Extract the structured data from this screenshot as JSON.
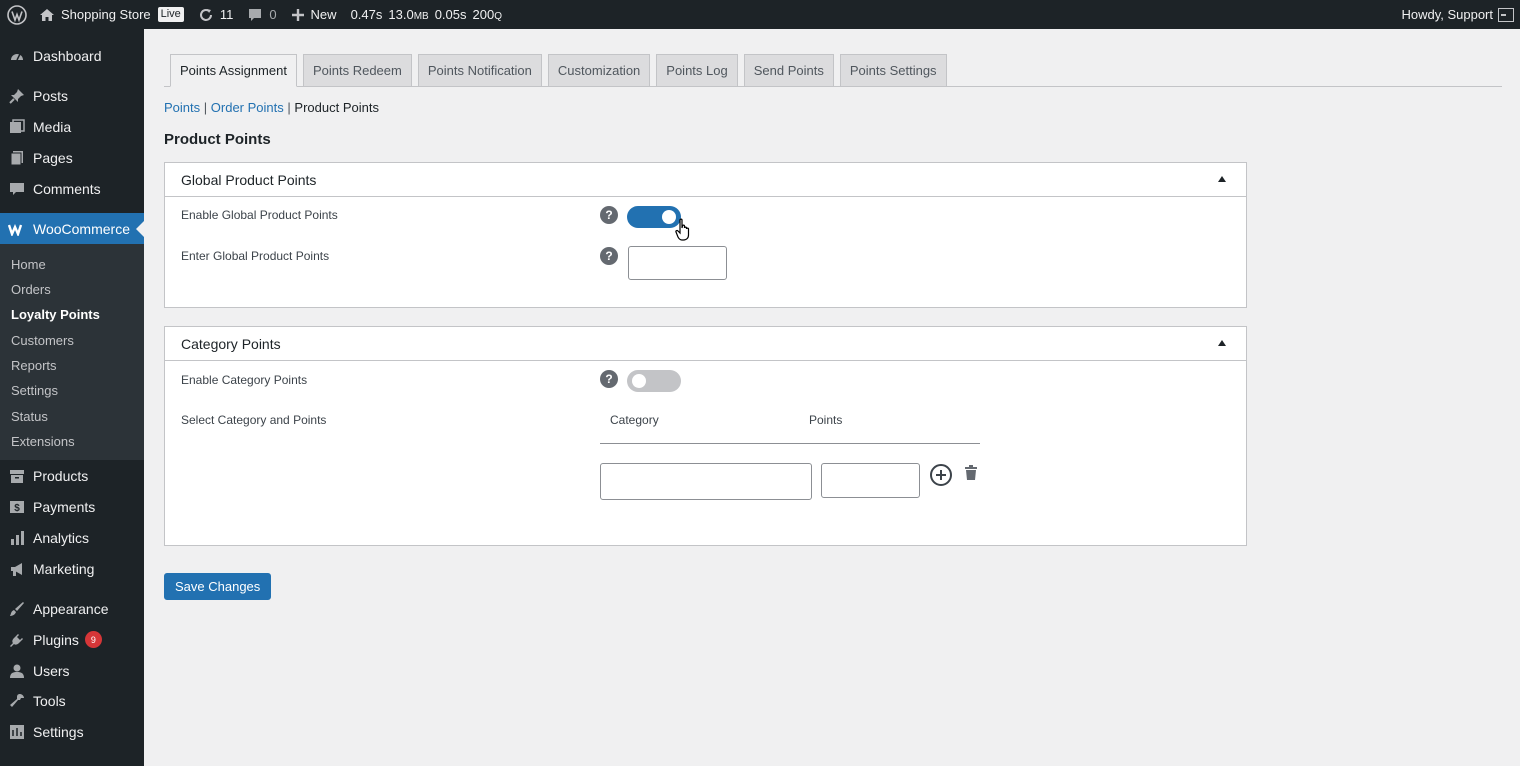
{
  "adminbar": {
    "site_name": "Shopping Store",
    "live_badge": "Live",
    "updates_count": "11",
    "comments_count": "0",
    "new_label": "New",
    "qm": {
      "time": "0.47s",
      "memory": "13.0",
      "memory_unit": "MB",
      "db_time": "0.05s",
      "queries": "200",
      "queries_unit": "Q"
    },
    "howdy": "Howdy, Support"
  },
  "sidebar": {
    "items": [
      {
        "label": "Dashboard",
        "icon": "dashboard-icon"
      },
      {
        "label": "Posts",
        "icon": "pin-icon"
      },
      {
        "label": "Media",
        "icon": "media-icon"
      },
      {
        "label": "Pages",
        "icon": "pages-icon"
      },
      {
        "label": "Comments",
        "icon": "comment-icon"
      },
      {
        "label": "WooCommerce",
        "icon": "woo-icon"
      },
      {
        "label": "Products",
        "icon": "archive-icon"
      },
      {
        "label": "Payments",
        "icon": "payment-icon"
      },
      {
        "label": "Analytics",
        "icon": "chart-icon"
      },
      {
        "label": "Marketing",
        "icon": "megaphone-icon"
      },
      {
        "label": "Appearance",
        "icon": "brush-icon"
      },
      {
        "label": "Plugins",
        "icon": "plug-icon",
        "badge": "9"
      },
      {
        "label": "Users",
        "icon": "user-icon"
      },
      {
        "label": "Tools",
        "icon": "wrench-icon"
      },
      {
        "label": "Settings",
        "icon": "settings-icon"
      }
    ],
    "submenu": [
      "Home",
      "Orders",
      "Loyalty Points",
      "Customers",
      "Reports",
      "Settings",
      "Status",
      "Extensions"
    ],
    "submenu_current": "Loyalty Points"
  },
  "tabs": [
    "Points Assignment",
    "Points Redeem",
    "Points Notification",
    "Customization",
    "Points Log",
    "Send Points",
    "Points Settings"
  ],
  "active_tab": "Points Assignment",
  "breadcrumb": {
    "link1": "Points",
    "sep": "|",
    "link2": "Order Points",
    "current": "Product Points"
  },
  "page_title": "Product Points",
  "global_section": {
    "title": "Global Product Points",
    "enable_label": "Enable Global Product Points",
    "enable_on": true,
    "points_label": "Enter Global Product Points",
    "points_value": ""
  },
  "category_section": {
    "title": "Category Points",
    "enable_label": "Enable Category Points",
    "enable_on": false,
    "select_label": "Select Category and Points",
    "col_category": "Category",
    "col_points": "Points",
    "category_value": "",
    "points_value": ""
  },
  "help_glyph": "?",
  "save_label": "Save Changes",
  "colors": {
    "accent": "#2271b1",
    "adminbar": "#1d2327",
    "badge": "#d63638"
  }
}
